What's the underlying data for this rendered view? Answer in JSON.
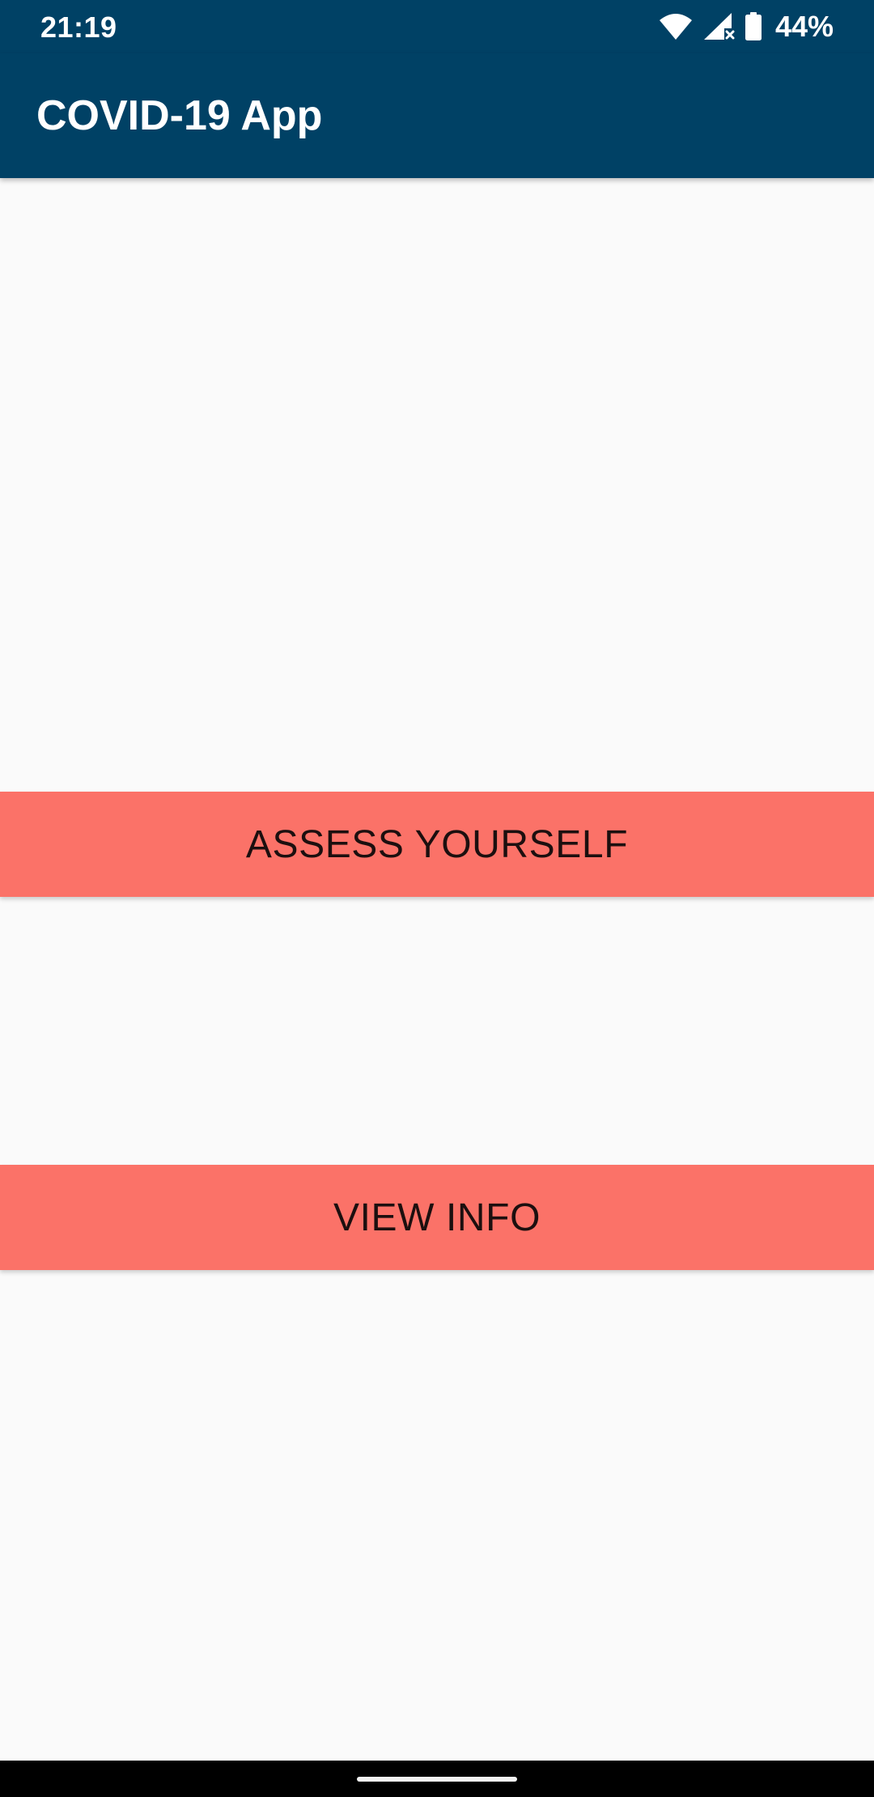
{
  "status_bar": {
    "time": "21:19",
    "battery_percent": "44%",
    "icons": [
      "wifi-icon",
      "cell-signal-no-service-icon",
      "battery-icon"
    ]
  },
  "app_bar": {
    "title": "COVID-19 App"
  },
  "main": {
    "assess_button_label": "ASSESS YOURSELF",
    "info_button_label": "VIEW INFO"
  },
  "colors": {
    "primary": "#004165",
    "button": "#fb7268",
    "background": "#fafafa",
    "button_text": "#1c0f0f"
  }
}
